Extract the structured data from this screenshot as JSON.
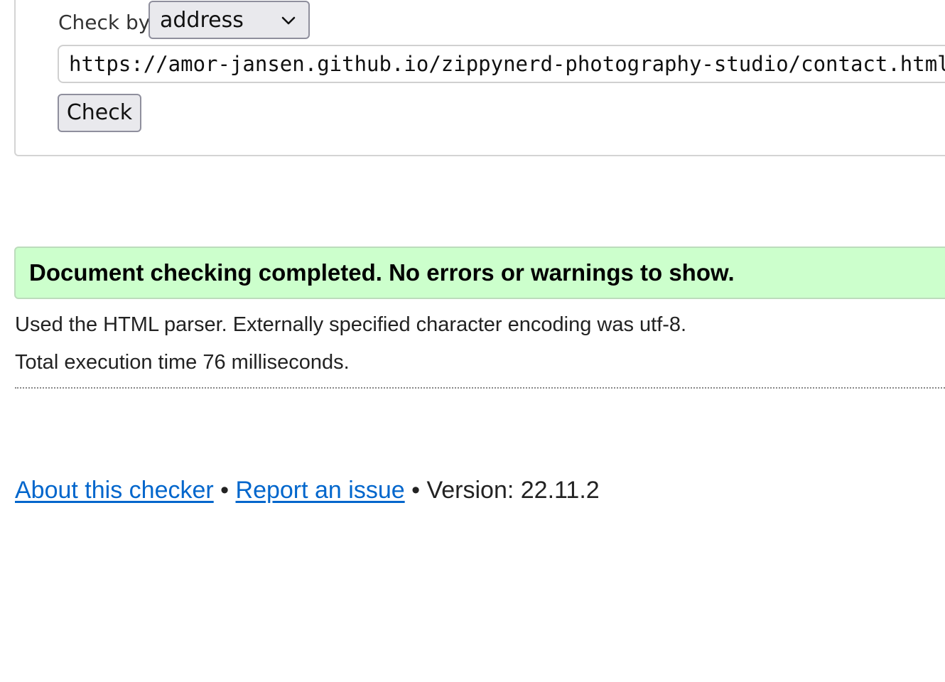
{
  "form": {
    "check_by_label": "Check by",
    "check_by_selected": "address",
    "url_value": "https://amor-jansen.github.io/zippynerd-photography-studio/contact.html",
    "check_button_label": "Check"
  },
  "result": {
    "status_message": "Document checking completed. No errors or warnings to show.",
    "status_color": "#ccffcc",
    "parser_info": "Used the HTML parser. Externally specified character encoding was utf-8.",
    "execution_time": "Total execution time 76 milliseconds."
  },
  "footer": {
    "about_link": "About this checker",
    "separator": "•",
    "report_link": "Report an issue",
    "version_text": "Version: 22.11.2",
    "link_color": "#0066cc"
  },
  "icons": {
    "select_arrow": "chevron-down-icon"
  }
}
